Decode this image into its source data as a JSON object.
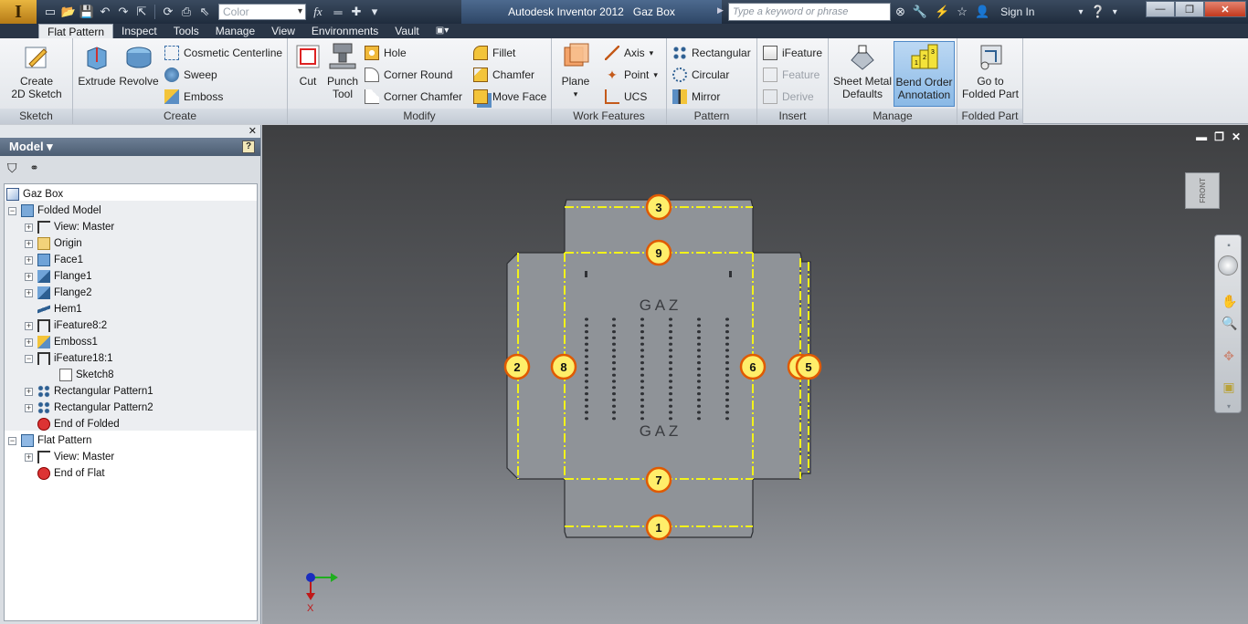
{
  "app": {
    "logo": "I",
    "title": "Autodesk Inventor 2012",
    "document": "Gaz Box"
  },
  "quick_access": {
    "icons": [
      "new-icon",
      "open-icon",
      "save-icon",
      "undo-icon",
      "redo-icon",
      "return-icon",
      "update-icon",
      "print-icon",
      "select-icon"
    ],
    "color_placeholder": "Color",
    "fx": "fx"
  },
  "search": {
    "placeholder": "Type a keyword or phrase"
  },
  "signin": "Sign In",
  "window_controls": {
    "minimize": "—",
    "restore": "❐",
    "close": "✕"
  },
  "menu_tabs": [
    "Flat Pattern",
    "Inspect",
    "Tools",
    "Manage",
    "View",
    "Environments",
    "Vault"
  ],
  "active_tab": "Flat Pattern",
  "ribbon": {
    "sketch": {
      "label": "Sketch",
      "create_2d_sketch": [
        "Create",
        "2D Sketch"
      ]
    },
    "create": {
      "label": "Create",
      "extrude": "Extrude",
      "revolve": "Revolve",
      "cosmetic_centerline": "Cosmetic Centerline",
      "sweep": "Sweep",
      "emboss": "Emboss"
    },
    "modify": {
      "label": "Modify",
      "cut": "Cut",
      "punch_tool": [
        "Punch",
        "Tool"
      ],
      "hole": "Hole",
      "corner_round": "Corner Round",
      "corner_chamfer": "Corner Chamfer",
      "fillet": "Fillet",
      "chamfer": "Chamfer",
      "move_face": "Move Face"
    },
    "work_features": {
      "label": "Work Features",
      "plane": "Plane",
      "axis": "Axis",
      "point": "Point",
      "ucs": "UCS"
    },
    "pattern": {
      "label": "Pattern",
      "rectangular": "Rectangular",
      "circular": "Circular",
      "mirror": "Mirror"
    },
    "insert": {
      "label": "Insert",
      "ifeature": "iFeature",
      "feature": "Feature",
      "derive": "Derive"
    },
    "manage": {
      "label": "Manage",
      "sheet_metal_defaults": [
        "Sheet Metal",
        "Defaults"
      ],
      "bend_order_annotation": [
        "Bend Order",
        "Annotation"
      ]
    },
    "folded_part": {
      "label": "Folded Part",
      "go_to_folded_part": [
        "Go to",
        "Folded Part"
      ]
    }
  },
  "browser": {
    "title": "Model",
    "help": "?",
    "tree": [
      {
        "label": "Gaz Box",
        "icon": "part-icon",
        "level": 0,
        "exp": ""
      },
      {
        "label": "Folded Model",
        "icon": "folded-model-icon",
        "level": 1,
        "exp": "−"
      },
      {
        "label": "View: Master",
        "icon": "view-icon",
        "level": 2,
        "exp": "+"
      },
      {
        "label": "Origin",
        "icon": "folder-icon",
        "level": 2,
        "exp": "+"
      },
      {
        "label": "Face1",
        "icon": "face-icon",
        "level": 2,
        "exp": "+"
      },
      {
        "label": "Flange1",
        "icon": "flange-icon",
        "level": 2,
        "exp": "+"
      },
      {
        "label": "Flange2",
        "icon": "flange-icon",
        "level": 2,
        "exp": "+"
      },
      {
        "label": "Hem1",
        "icon": "hem-icon",
        "level": 2,
        "exp": ""
      },
      {
        "label": "iFeature8:2",
        "icon": "ifeature-icon",
        "level": 2,
        "exp": "+"
      },
      {
        "label": "Emboss1",
        "icon": "emboss-icon",
        "level": 2,
        "exp": "+"
      },
      {
        "label": "iFeature18:1",
        "icon": "ifeature-icon",
        "level": 2,
        "exp": "−"
      },
      {
        "label": "Sketch8",
        "icon": "sketch-icon",
        "level": 3,
        "exp": ""
      },
      {
        "label": "Rectangular Pattern1",
        "icon": "pattern-icon",
        "level": 2,
        "exp": "+"
      },
      {
        "label": "Rectangular Pattern2",
        "icon": "pattern-icon",
        "level": 2,
        "exp": "+"
      },
      {
        "label": "End of Folded",
        "icon": "end-icon",
        "level": 2,
        "exp": ""
      },
      {
        "label": "Flat Pattern",
        "icon": "flat-pattern-icon",
        "level": 1,
        "exp": "−"
      },
      {
        "label": "View: Master",
        "icon": "view-icon",
        "level": 2,
        "exp": "+"
      },
      {
        "label": "End of Flat",
        "icon": "end-icon",
        "level": 2,
        "exp": ""
      }
    ]
  },
  "viewport": {
    "viewcube_face": "FRONT",
    "engraving_top": "G A Z",
    "engraving_bottom": "G A Z",
    "bend_markers": [
      "1",
      "2",
      "3",
      "4",
      "5",
      "6",
      "7",
      "8",
      "9"
    ],
    "colors": {
      "bend_line": "#f2f21a",
      "marker_fill": "#ffee6a",
      "marker_ring": "#e05a00",
      "part": "#8f9398"
    },
    "triad_label": "X"
  }
}
